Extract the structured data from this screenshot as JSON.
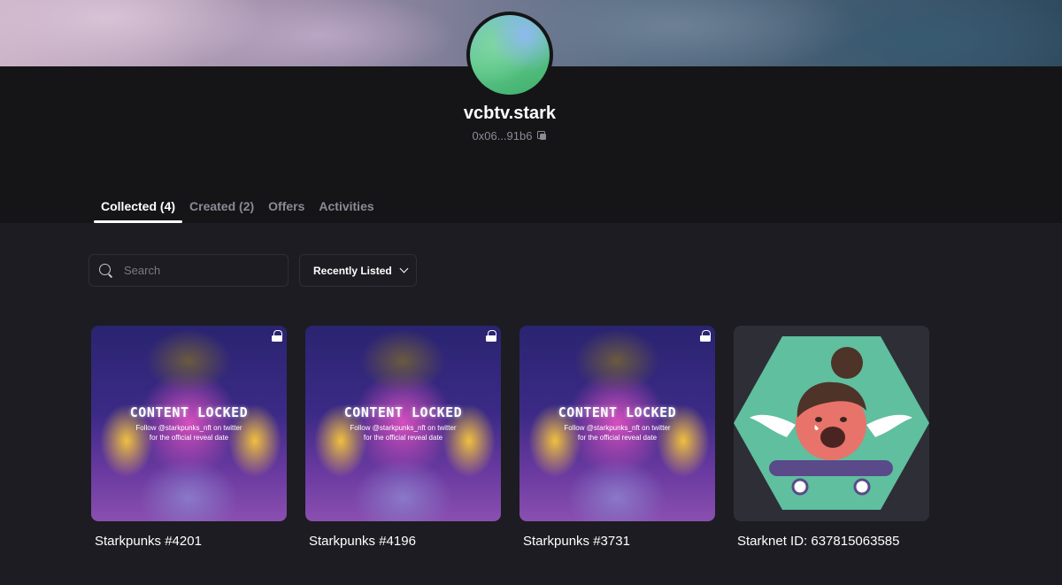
{
  "profile": {
    "username": "vcbtv.stark",
    "address": "0x06...91b6"
  },
  "tabs": [
    {
      "label": "Collected (4)",
      "active": true
    },
    {
      "label": "Created (2)",
      "active": false
    },
    {
      "label": "Offers",
      "active": false
    },
    {
      "label": "Activities",
      "active": false
    }
  ],
  "filters": {
    "search_placeholder": "Search",
    "sort_label": "Recently Listed"
  },
  "cards": [
    {
      "name": "Starkpunks #4201",
      "locked": true,
      "locked_title": "CONTENT LOCKED",
      "locked_line1": "Follow @starkpunks_nft on twitter",
      "locked_line2": "for the official reveal date"
    },
    {
      "name": "Starkpunks #4196",
      "locked": true,
      "locked_title": "CONTENT LOCKED",
      "locked_line1": "Follow @starkpunks_nft on twitter",
      "locked_line2": "for the official reveal date"
    },
    {
      "name": "Starkpunks #3731",
      "locked": true,
      "locked_title": "CONTENT LOCKED",
      "locked_line1": "Follow @starkpunks_nft on twitter",
      "locked_line2": "for the official reveal date"
    },
    {
      "name": "Starknet ID: 637815063585",
      "locked": false
    }
  ],
  "icons": {
    "search": "search-icon",
    "copy": "copy-icon",
    "lock": "lock-icon",
    "chevron": "chevron-down-icon"
  },
  "colors": {
    "background": "#1c1c22",
    "header": "#151517",
    "muted_text": "#8b8b96",
    "starknet_hex": "#5fbf9f"
  }
}
